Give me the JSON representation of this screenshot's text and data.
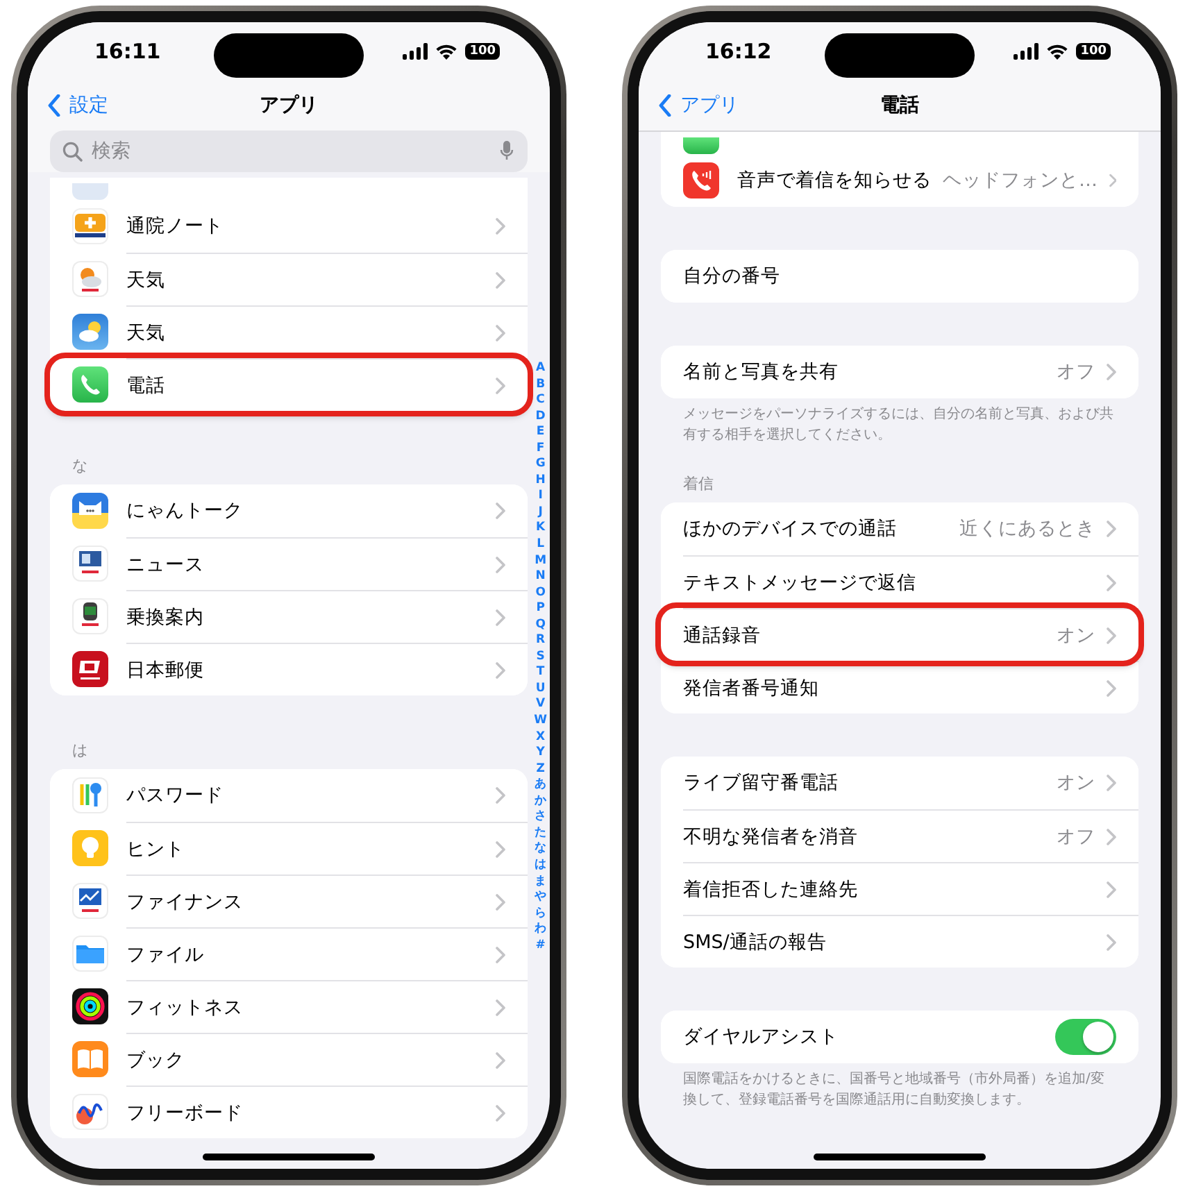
{
  "phones": [
    {
      "time": "16:11",
      "battery": "100",
      "back": "設定",
      "title": "アプリ",
      "search": {
        "placeholder": "検索"
      },
      "sections": [
        {
          "rows": [
            {
              "label": "通院ノート",
              "highlighted": false
            },
            {
              "label": "天気",
              "highlighted": false
            },
            {
              "label": "天気",
              "highlighted": false
            },
            {
              "label": "電話",
              "highlighted": true
            }
          ]
        },
        {
          "header": "な",
          "rows": [
            {
              "label": "にゃんトーク",
              "highlighted": false
            },
            {
              "label": "ニュース",
              "highlighted": false
            },
            {
              "label": "乗換案内",
              "highlighted": false
            },
            {
              "label": "日本郵便",
              "highlighted": false
            }
          ]
        },
        {
          "header": "は",
          "rows": [
            {
              "label": "パスワード",
              "highlighted": false
            },
            {
              "label": "ヒント",
              "highlighted": false
            },
            {
              "label": "ファイナンス",
              "highlighted": false
            },
            {
              "label": "ファイル",
              "highlighted": false
            },
            {
              "label": "フィットネス",
              "highlighted": false
            },
            {
              "label": "ブック",
              "highlighted": false
            },
            {
              "label": "フリーボード",
              "highlighted": false
            }
          ]
        }
      ],
      "index": [
        "A",
        "B",
        "C",
        "D",
        "E",
        "F",
        "G",
        "H",
        "I",
        "J",
        "K",
        "L",
        "M",
        "N",
        "O",
        "P",
        "Q",
        "R",
        "S",
        "T",
        "U",
        "V",
        "W",
        "X",
        "Y",
        "Z",
        "あ",
        "か",
        "さ",
        "た",
        "な",
        "は",
        "ま",
        "や",
        "ら",
        "わ",
        "#"
      ]
    },
    {
      "time": "16:12",
      "battery": "100",
      "back": "アプリ",
      "title": "電話",
      "sections": [
        {
          "rows": [
            {
              "kind": "link",
              "label": "音声で着信を知らせる",
              "value": "ヘッドフォンと…",
              "highlighted": false
            }
          ]
        },
        {
          "rows": [
            {
              "kind": "plain",
              "label": "自分の番号",
              "highlighted": false
            }
          ]
        },
        {
          "rows": [
            {
              "kind": "link",
              "label": "名前と写真を共有",
              "value": "オフ",
              "highlighted": false
            }
          ],
          "footer": "メッセージをパーソナライズするには、自分の名前と写真、および共有する相手を選択してください。"
        },
        {
          "header": "着信",
          "rows": [
            {
              "kind": "link",
              "label": "ほかのデバイスでの通話",
              "value": "近くにあるとき",
              "highlighted": false
            },
            {
              "kind": "link",
              "label": "テキストメッセージで返信",
              "highlighted": false
            },
            {
              "kind": "link",
              "label": "通話録音",
              "value": "オン",
              "highlighted": true
            },
            {
              "kind": "link",
              "label": "発信者番号通知",
              "highlighted": false
            }
          ]
        },
        {
          "rows": [
            {
              "kind": "link",
              "label": "ライブ留守番電話",
              "value": "オン",
              "highlighted": false
            },
            {
              "kind": "link",
              "label": "不明な発信者を消音",
              "value": "オフ",
              "highlighted": false
            },
            {
              "kind": "link",
              "label": "着信拒否した連絡先",
              "highlighted": false
            },
            {
              "kind": "link",
              "label": "SMS/通話の報告",
              "highlighted": false
            }
          ]
        },
        {
          "rows": [
            {
              "kind": "toggle",
              "label": "ダイヤルアシスト",
              "on": true,
              "highlighted": false
            }
          ],
          "footer": "国際電話をかけるときに、国番号と地域番号（市外局番）を追加/変換して、登録電話番号を国際通話用に自動変換します。"
        }
      ]
    }
  ]
}
